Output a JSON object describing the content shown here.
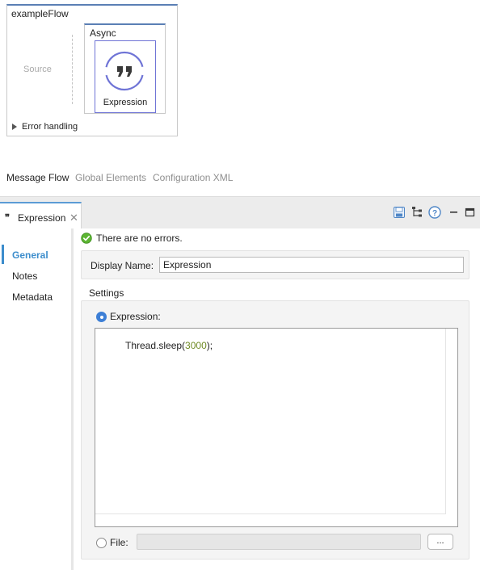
{
  "flow": {
    "name": "exampleFlow",
    "source_label": "Source",
    "scope_label": "Async",
    "component_label": "Expression",
    "error_handling_label": "Error handling"
  },
  "editor_tabs": [
    "Message Flow",
    "Global Elements",
    "Configuration XML"
  ],
  "properties": {
    "tab_label": "Expression",
    "tab_icon": "quote-icon",
    "toolbar_icons": [
      "save-icon",
      "tree-icon",
      "help-icon",
      "minimize-icon",
      "maximize-icon"
    ],
    "sidebar": [
      "General",
      "Notes",
      "Metadata"
    ],
    "active_section": "General",
    "status_text": "There are no errors.",
    "display_name_label": "Display Name:",
    "display_name_value": "Expression",
    "settings_label": "Settings",
    "expression_radio_label": "Expression:",
    "expression_code_prefix": "Thread.sleep(",
    "expression_code_number": "3000",
    "expression_code_suffix": ");",
    "file_radio_label": "File:",
    "file_value": "",
    "browse_label": "..."
  },
  "colors": {
    "accent": "#3c8dcc",
    "component_border": "#6f74d6",
    "ok_green": "#5cb532",
    "code_number": "#6f8a24"
  }
}
